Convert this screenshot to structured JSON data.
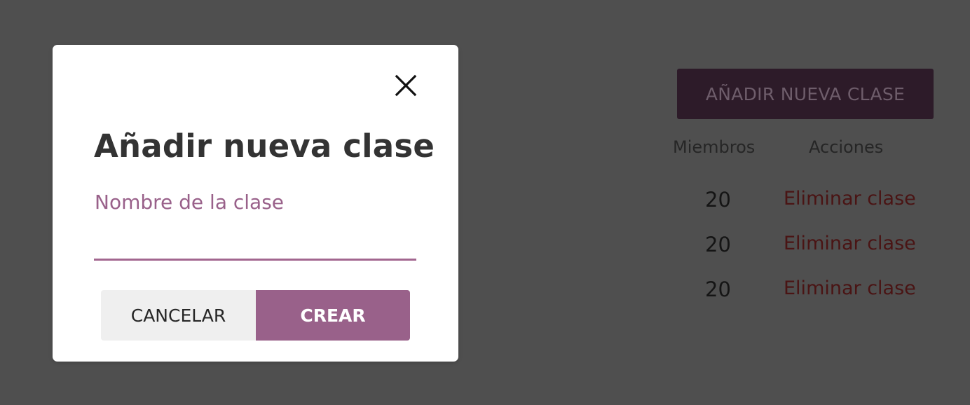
{
  "background": {
    "add_class_button": "AÑADIR NUEVA CLASE",
    "table": {
      "columns": [
        "Miembros",
        "Acciones"
      ],
      "rows": [
        {
          "members": "20",
          "action": "Eliminar clase"
        },
        {
          "members": "20",
          "action": "Eliminar clase"
        },
        {
          "members": "20",
          "action": "Eliminar clase"
        }
      ]
    }
  },
  "modal": {
    "title": "Añadir nueva clase",
    "field_label": "Nombre de la clase",
    "input_value": "",
    "cancel_label": "CANCELAR",
    "create_label": "CREAR",
    "close_icon": "close-icon"
  },
  "colors": {
    "accent": "#99618a",
    "overlay_background": "#4f4f4f",
    "danger_text": "#4a1414"
  }
}
